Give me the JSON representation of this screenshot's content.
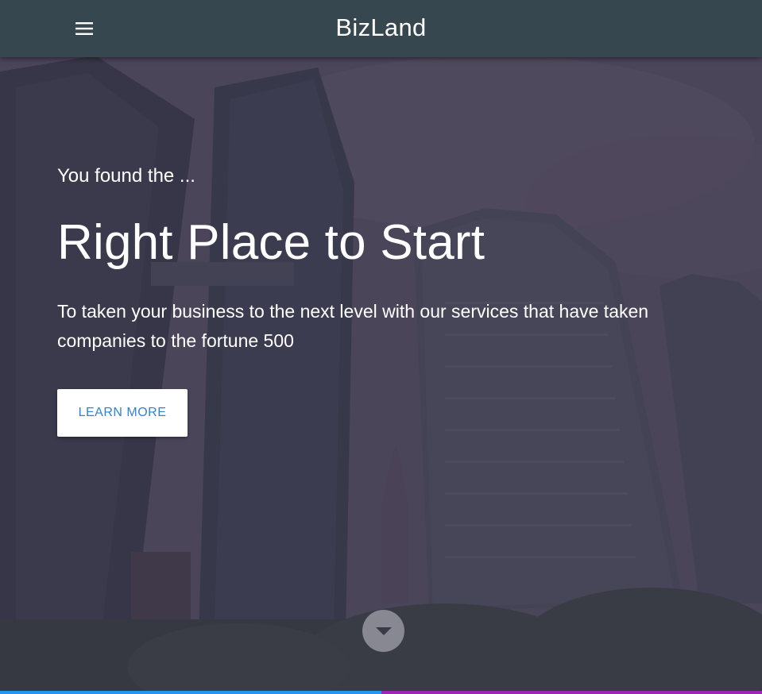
{
  "app": {
    "brand": "BizLand",
    "menu_icon": "menu-icon"
  },
  "hero": {
    "kicker": "You found the ...",
    "headline": "Right Place to Start",
    "subtext": "To taken your business to the next level with our services that have taken companies to the fortune 500",
    "cta_label": "LEARN MORE",
    "scroll_icon": "caret-down-icon"
  },
  "colors": {
    "appbar": "#37474f",
    "cta_text": "#2f83d4",
    "accent_left": "#2196f3",
    "accent_right": "#9c27b0"
  }
}
